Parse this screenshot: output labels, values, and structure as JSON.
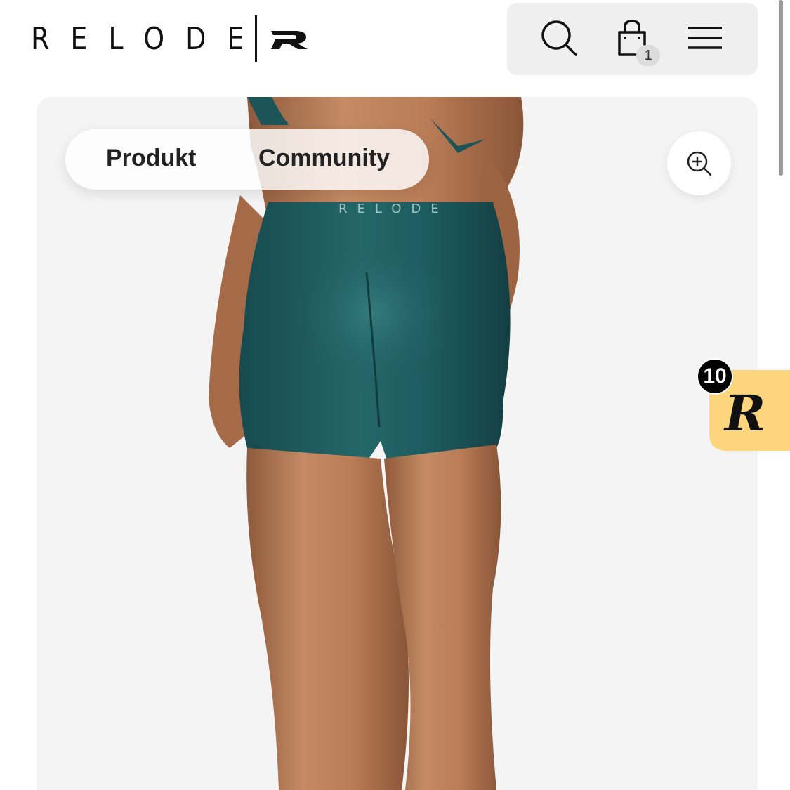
{
  "header": {
    "logo_text": "RELODE",
    "cart_count": "1",
    "icons": [
      "search-icon",
      "shopping-bag-icon",
      "menu-icon"
    ]
  },
  "product": {
    "tabs": [
      {
        "label": "Produkt"
      },
      {
        "label": "Community"
      }
    ],
    "waistband_text": "RELODE",
    "zoom_icon": "zoom-in-icon"
  },
  "rewards": {
    "count": "10",
    "letter": "R"
  },
  "colors": {
    "teal": "#1f5a5e",
    "rewards_bg": "#fdd57c",
    "icon_bar_bg": "#efefef",
    "skin": "#b97c57"
  }
}
